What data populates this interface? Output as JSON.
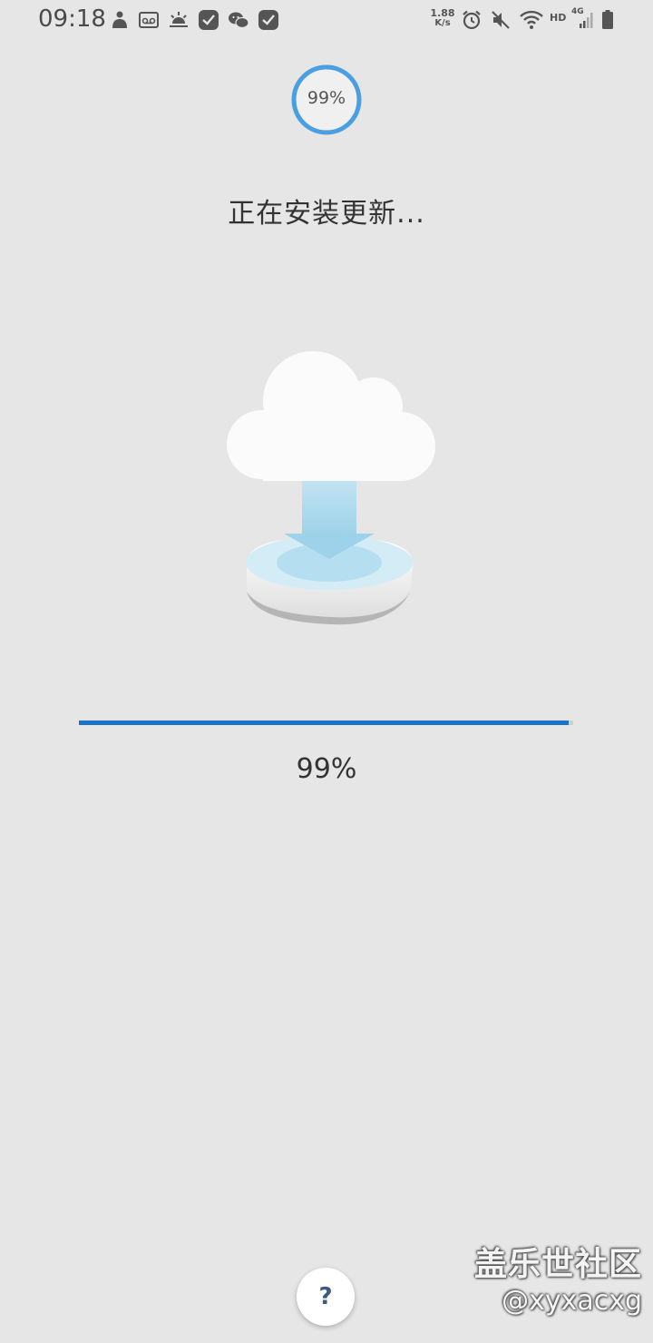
{
  "status_bar": {
    "time": "09:18",
    "net_speed_value": "1.88",
    "net_speed_unit": "K/s",
    "hd_label": "HD",
    "network_label": "4G",
    "icons": [
      "person-icon",
      "voicemail-icon",
      "weather-icon",
      "check-app-icon",
      "wechat-icon",
      "check-app-icon",
      "alarm-icon",
      "mute-icon",
      "wifi-icon",
      "signal-icon",
      "battery-icon"
    ]
  },
  "progress": {
    "ring_label": "99%",
    "percent": 99,
    "label": "99%"
  },
  "title": "正在安装更新...",
  "illustration": "cloud-download-icon",
  "help_button": {
    "label": "?"
  },
  "watermark": {
    "site": "盖乐世社区",
    "user": "@xyxacxg"
  },
  "colors": {
    "background": "#e6e6e6",
    "progress_fill": "#1a73c8",
    "ring_color": "#4a9fe0"
  }
}
